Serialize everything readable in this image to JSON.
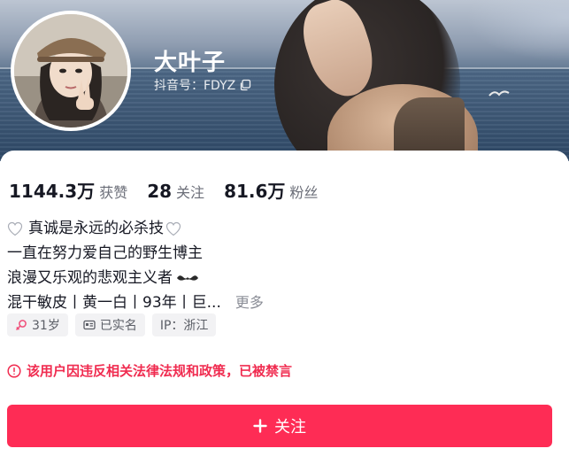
{
  "profile": {
    "name": "大叶子",
    "douyin_id_text": "抖音号：FDYZ"
  },
  "stats": [
    {
      "value": "1144.3万",
      "label": "获赞"
    },
    {
      "value": "28",
      "label": "关注"
    },
    {
      "value": "81.6万",
      "label": "粉丝"
    }
  ],
  "bio": {
    "lines": [
      "真诚是永远的必杀技",
      "一直在努力爱自己的野生博主",
      "浪漫又乐观的悲观主义者",
      "混干敏皮丨黄一白丨93年丨巨..."
    ],
    "more_label": "更多"
  },
  "tags": [
    {
      "icon": "female-icon",
      "label": "31岁"
    },
    {
      "icon": "id-card-icon",
      "label": "已实名"
    },
    {
      "icon": "",
      "label": "IP：浙江"
    }
  ],
  "ban_notice": {
    "icon": "warning-icon",
    "text": "该用户因违反相关法律法规和政策，已被禁言"
  },
  "follow_button": {
    "label": "关注"
  },
  "colors": {
    "accent": "#fe2c55",
    "warning": "#f02c50",
    "text_primary": "#161823",
    "text_secondary": "#6b6e78",
    "tag_bg": "#f2f2f4"
  }
}
